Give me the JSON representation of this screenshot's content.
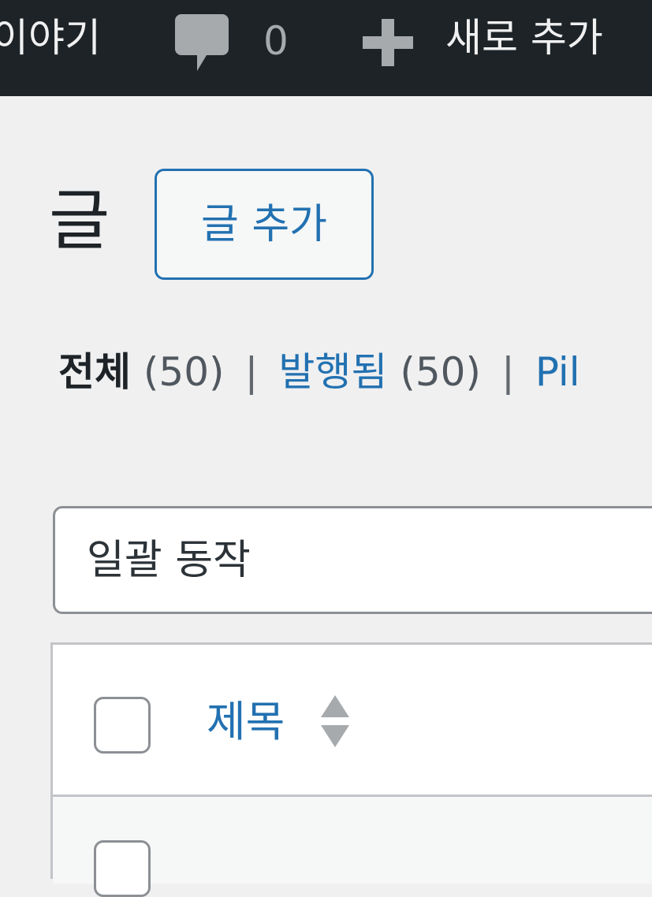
{
  "adminbar": {
    "site_name": "이야기",
    "comments_count": "0",
    "new_label": "새로 추가",
    "icons": {
      "comments": "comment-bubble-icon",
      "new": "plus-icon"
    }
  },
  "page": {
    "title": "글",
    "add_new_label": "글 추가"
  },
  "filters": {
    "all_label": "전체",
    "all_count": "(50)",
    "published_label": "발행됨",
    "published_count": "(50)",
    "separator": "|",
    "third_label": "Pil"
  },
  "bulk_actions": {
    "selected": "일괄 동작"
  },
  "table": {
    "columns": [
      {
        "label": "제목",
        "sortable": true
      }
    ],
    "rows": [
      {
        "title": ""
      }
    ]
  },
  "colors": {
    "adminbar_bg": "#1d2327",
    "link": "#2271b1",
    "background": "#f0f0f1",
    "border": "#c3c4c7"
  }
}
